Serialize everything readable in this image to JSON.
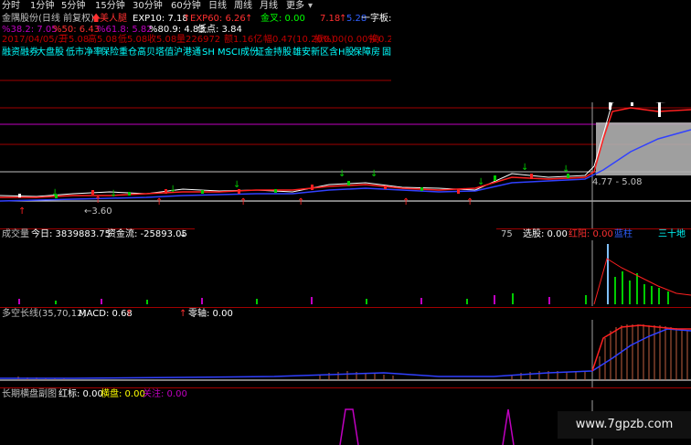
{
  "toolbar": {
    "periods": [
      "分时",
      "1分钟",
      "5分钟",
      "15分钟",
      "30分钟",
      "60分钟",
      "日线",
      "周线",
      "月线",
      "更多"
    ],
    "more_icon": "chevron-down-icon"
  },
  "header": {
    "stock_name": "金隅股份(日线 前复权)",
    "signal_label": "美人腿",
    "exp10": "EXP10: 7.18",
    "exp60": "EXP60: 6.26",
    "golden_cross": "金叉: 0.00",
    "val_718": "7.18",
    "val_528": "5.28",
    "yizi": "一字板:"
  },
  "fib": {
    "p382": "%38.2: 7.05",
    "p50": "%50: 6.43",
    "p618": "%61.8: 5.82",
    "p809": "%80.9: 4.83",
    "low_label": "低点: 3.84"
  },
  "quote": {
    "date": "2017/04/05/三",
    "open": "开5.08",
    "high": "高5.08",
    "low": "低5.08",
    "close": "收5.08",
    "volume": "量226972",
    "amount": "额1.16亿",
    "amplitude": "幅0.47(10.20%)",
    "swing": "振0.00(0.00%)",
    "turnover": "换0.2"
  },
  "concepts": [
    "融资融券",
    "大盘股",
    "低市净率",
    "保险重仓",
    "高贝塔值",
    "沪港通",
    "SH MSCI成份",
    "证金持股",
    "雄安新区",
    "含H股",
    "保障房",
    "固"
  ],
  "price_panel": {
    "low_mark": "3.60",
    "range_mark": "4.77 - 5.08"
  },
  "volume_panel": {
    "title": "成交量",
    "today": "今日: 3839883.75",
    "fund_flow": "资金流: -25893.05",
    "fund_flow_value": -25893.05,
    "right_val": "75",
    "select": "选股: 0.00",
    "red_sun": "红阳: 0.00",
    "blue_label": "蓝柱",
    "three_ten": "三十地"
  },
  "macd_panel": {
    "title": "多空长线(35,70,12)",
    "macd": "MACD: 0.68",
    "zero_axis": "零轴: 0.00"
  },
  "long_panel": {
    "title": "长期横盘副图",
    "red_mark": "红标: 0.00",
    "sideways": "横盘: 0.00",
    "attention": "关注: 0.00"
  },
  "watermark": "www.7gpzb.com",
  "colors": {
    "grid_red": "#a00000",
    "ma_white": "#ffffff",
    "ma_red": "#ff2020",
    "ma_blue": "#3040ff",
    "up_green": "#00cc00",
    "down_red": "#ff2020",
    "magenta": "#c000c0",
    "cyan": "#00ffff",
    "yellow": "#ffff00",
    "gray_box": "#b0b0b0"
  }
}
